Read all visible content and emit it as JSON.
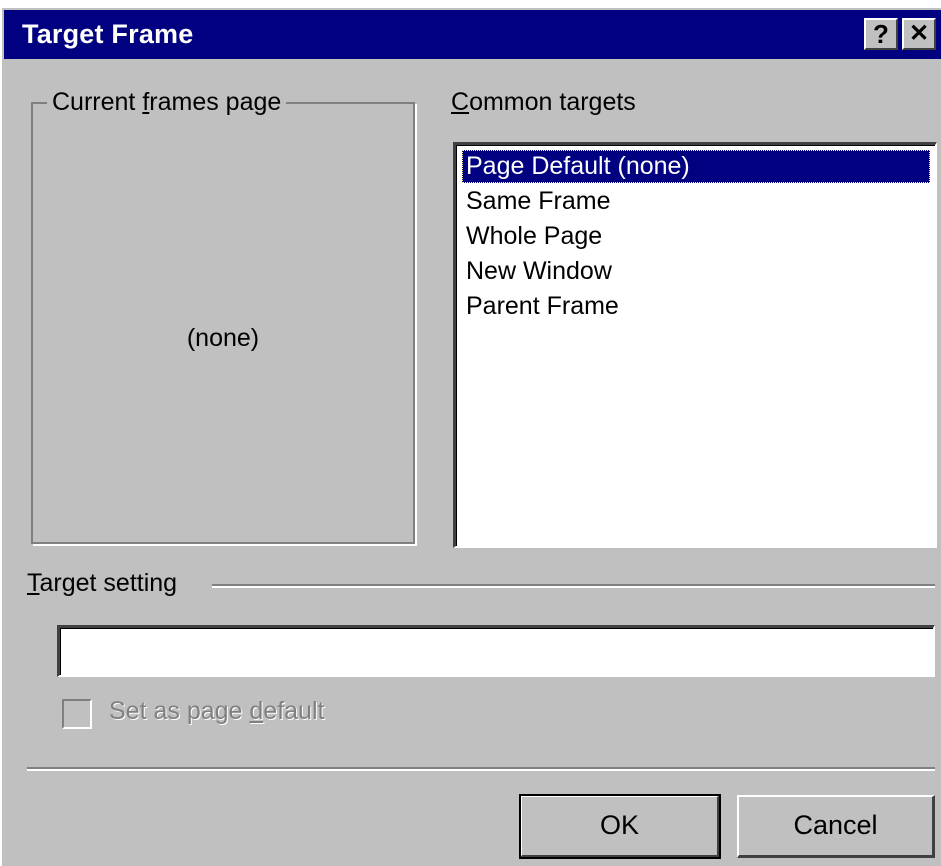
{
  "dialog": {
    "title": "Target Frame",
    "help_button": "?",
    "close_button": "✕"
  },
  "current_frames": {
    "legend_prefix": "Current ",
    "legend_accel": "f",
    "legend_suffix": "rames page",
    "value": "(none)"
  },
  "common_targets": {
    "label_accel": "C",
    "label_rest": "ommon targets",
    "items": [
      "Page Default (none)",
      "Same Frame",
      "Whole Page",
      "New Window",
      "Parent Frame"
    ],
    "selected_index": 0
  },
  "target_setting": {
    "label_accel": "T",
    "label_rest": "arget setting",
    "value": ""
  },
  "page_default_checkbox": {
    "label_prefix": "Set as page ",
    "label_accel": "d",
    "label_suffix": "efault",
    "checked": false,
    "enabled": false
  },
  "buttons": {
    "ok": "OK",
    "cancel": "Cancel"
  },
  "colors": {
    "face": "#c0c0c0",
    "titlebar": "#000080",
    "selection": "#000080"
  }
}
